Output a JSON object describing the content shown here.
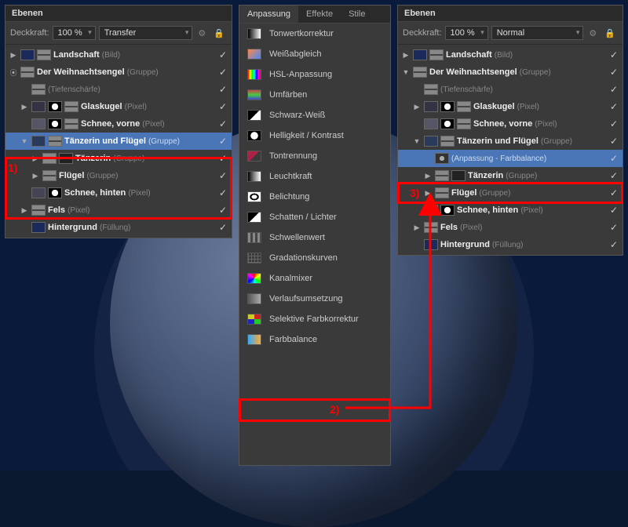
{
  "annotations": {
    "n1": "1)",
    "n2": "2)",
    "n3": "3)"
  },
  "leftPanel": {
    "title": "Ebenen",
    "opacityLabel": "Deckkraft:",
    "opacityValue": "100 %",
    "blendMode": "Transfer",
    "layers": [
      {
        "name": "Landschaft",
        "type": "(Bild)"
      },
      {
        "name": "Der Weihnachtsengel",
        "type": "(Gruppe)"
      },
      {
        "name": "(Tiefenschärfe)",
        "type": ""
      },
      {
        "name": "Glaskugel",
        "type": "(Pixel)"
      },
      {
        "name": "Schnee, vorne",
        "type": "(Pixel)"
      },
      {
        "name": "Tänzerin und Flügel",
        "type": "(Gruppe)"
      },
      {
        "name": "Tänzerin",
        "type": "(Gruppe)"
      },
      {
        "name": "Flügel",
        "type": "(Gruppe)"
      },
      {
        "name": "Schnee, hinten",
        "type": "(Pixel)"
      },
      {
        "name": "Fels",
        "type": "(Pixel)"
      },
      {
        "name": "Hintergrund",
        "type": "(Füllung)"
      }
    ]
  },
  "adjPanel": {
    "tabs": [
      "Anpassung",
      "Effekte",
      "Stile"
    ],
    "items": [
      "Tonwertkorrektur",
      "Weißabgleich",
      "HSL-Anpassung",
      "Umfärben",
      "Schwarz-Weiß",
      "Helligkeit / Kontrast",
      "Tontrennung",
      "Leuchtkraft",
      "Belichtung",
      "Schatten / Lichter",
      "Schwellenwert",
      "Gradationskurven",
      "Kanalmixer",
      "Verlaufsumsetzung",
      "Selektive Farbkorrektur",
      "Farbbalance"
    ]
  },
  "rightPanel": {
    "title": "Ebenen",
    "opacityLabel": "Deckkraft:",
    "opacityValue": "100 %",
    "blendMode": "Normal",
    "layers": [
      {
        "name": "Landschaft",
        "type": "(Bild)"
      },
      {
        "name": "Der Weihnachtsengel",
        "type": "(Gruppe)"
      },
      {
        "name": "(Tiefenschärfe)",
        "type": ""
      },
      {
        "name": "Glaskugel",
        "type": "(Pixel)"
      },
      {
        "name": "Schnee, vorne",
        "type": "(Pixel)"
      },
      {
        "name": "Tänzerin und Flügel",
        "type": "(Gruppe)"
      },
      {
        "name": "(Anpassung - Farbbalance)",
        "type": ""
      },
      {
        "name": "Tänzerin",
        "type": "(Gruppe)"
      },
      {
        "name": "Flügel",
        "type": "(Gruppe)"
      },
      {
        "name": "Schnee, hinten",
        "type": "(Pixel)"
      },
      {
        "name": "Fels",
        "type": "(Pixel)"
      },
      {
        "name": "Hintergrund",
        "type": "(Füllung)"
      }
    ]
  }
}
